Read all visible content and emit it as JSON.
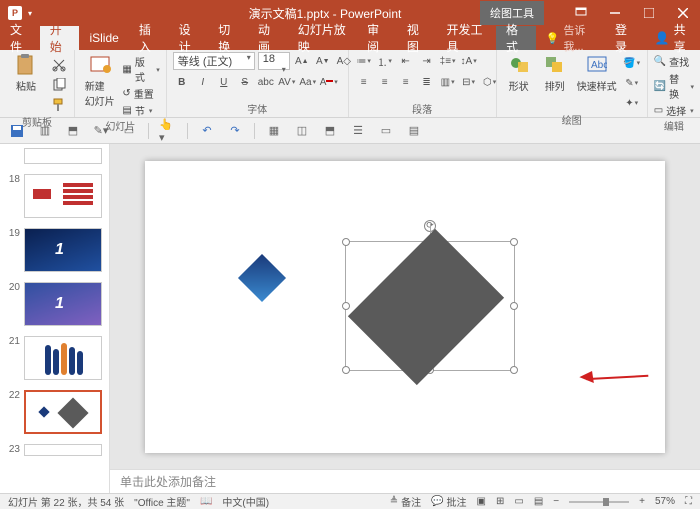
{
  "title": "演示文稿1.pptx - PowerPoint",
  "context_tab": "绘图工具",
  "tabs": {
    "file": "文件",
    "home": "开始",
    "islide": "iSlide",
    "insert": "插入",
    "design": "设计",
    "transitions": "切换",
    "animations": "动画",
    "slideshow": "幻灯片放映",
    "review": "审阅",
    "view": "视图",
    "developer": "开发工具",
    "format": "格式",
    "tellme": "告诉我..."
  },
  "account": {
    "login": "登录",
    "share": "共享"
  },
  "ribbon": {
    "clipboard": {
      "label": "剪贴板",
      "paste": "粘贴"
    },
    "slides": {
      "label": "幻灯片",
      "new": "新建\n幻灯片",
      "layout": "版式",
      "reset": "重置",
      "section": "节"
    },
    "font": {
      "label": "字体",
      "name": "等线 (正文)",
      "size": "18"
    },
    "para": {
      "label": "段落"
    },
    "drawing": {
      "label": "绘图",
      "shapes": "形状",
      "arrange": "排列",
      "quick": "快速样式"
    },
    "editing": {
      "label": "编辑",
      "find": "查找",
      "replace": "替换",
      "select": "选择"
    }
  },
  "notes_placeholder": "单击此处添加备注",
  "status": {
    "slide_of": "幻灯片 第 22 张，共 54 张",
    "theme": "\"Office 主题\"",
    "lang": "中文(中国)",
    "notes_btn": "备注",
    "comments_btn": "批注",
    "zoom": "57%"
  },
  "thumbs": [
    {
      "num": "18"
    },
    {
      "num": "19"
    },
    {
      "num": "20"
    },
    {
      "num": "21"
    },
    {
      "num": "22"
    },
    {
      "num": "23"
    }
  ]
}
